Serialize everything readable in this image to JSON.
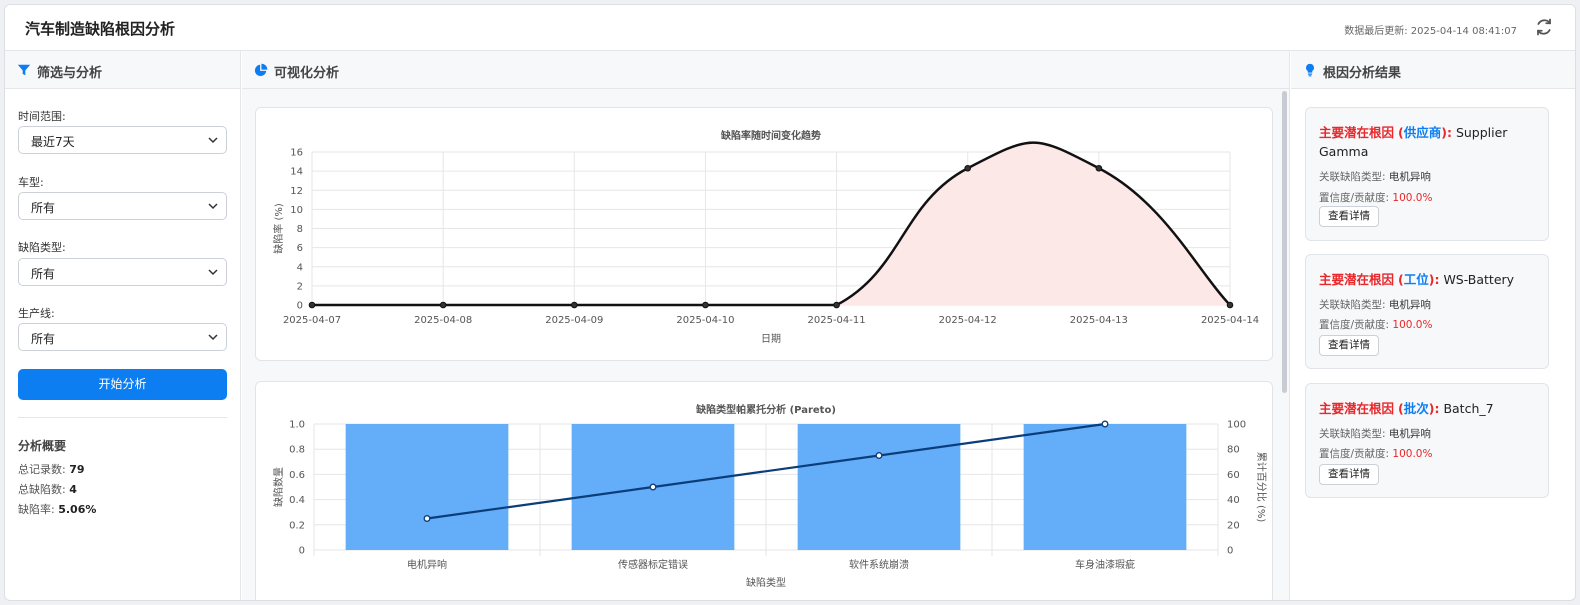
{
  "header": {
    "title": "汽车制造缺陷根因分析",
    "updated_label": "数据最后更新: 2025-04-14 08:41:07"
  },
  "filters": {
    "panel_title": "筛选与分析",
    "time_label": "时间范围:",
    "time_value": "最近7天",
    "model_label": "车型:",
    "model_value": "所有",
    "defect_label": "缺陷类型:",
    "defect_value": "所有",
    "line_label": "生产线:",
    "line_value": "所有",
    "analyze_button": "开始分析"
  },
  "summary": {
    "title": "分析概要",
    "total_records_label": "总记录数:",
    "total_records": "79",
    "total_defects_label": "总缺陷数:",
    "total_defects": "4",
    "defect_rate_label": "缺陷率:",
    "defect_rate": "5.06%"
  },
  "viz": {
    "panel_title": "可视化分析"
  },
  "rootcause": {
    "panel_title": "根因分析结果",
    "cards": [
      {
        "prefix": "主要潜在根因",
        "category": "供应商",
        "value": "Supplier Gamma",
        "related_label": "关联缺陷类型:",
        "related_value": "电机异响",
        "conf_label": "置信度/贡献度:",
        "conf_value": "100.0%",
        "button": "查看详情"
      },
      {
        "prefix": "主要潜在根因",
        "category": "工位",
        "value": "WS-Battery",
        "related_label": "关联缺陷类型:",
        "related_value": "电机异响",
        "conf_label": "置信度/贡献度:",
        "conf_value": "100.0%",
        "button": "查看详情"
      },
      {
        "prefix": "主要潜在根因",
        "category": "批次",
        "value": "Batch_7",
        "related_label": "关联缺陷类型:",
        "related_value": "电机异响",
        "conf_label": "置信度/贡献度:",
        "conf_value": "100.0%",
        "button": "查看详情"
      }
    ]
  },
  "colors": {
    "accent": "#0d7ef2",
    "alert": "#e8282b",
    "bar": "#64adf9",
    "area": "#fde8e8"
  },
  "chart_data": [
    {
      "type": "area",
      "title": "缺陷率随时间变化趋势",
      "xlabel": "日期",
      "ylabel": "缺陷率 (%)",
      "ylim": [
        0,
        16
      ],
      "yticks": [
        0,
        2,
        4,
        6,
        8,
        10,
        12,
        14,
        16
      ],
      "x": [
        "2025-04-07",
        "2025-04-08",
        "2025-04-09",
        "2025-04-10",
        "2025-04-11",
        "2025-04-12",
        "2025-04-13",
        "2025-04-14"
      ],
      "values": [
        0,
        0,
        0,
        0,
        0,
        14.3,
        14.3,
        0
      ],
      "grid": true
    },
    {
      "type": "bar",
      "title": "缺陷类型帕累托分析 (Pareto)",
      "xlabel": "缺陷类型",
      "ylabel": "缺陷数量",
      "y2label": "累计百分比 (%)",
      "ylim": [
        0,
        1.0
      ],
      "yticks": [
        0,
        0.2,
        0.4,
        0.6,
        0.8,
        1.0
      ],
      "y2lim": [
        0,
        100
      ],
      "y2ticks": [
        0,
        20,
        40,
        60,
        80,
        100
      ],
      "categories": [
        "电机异响",
        "传感器标定错误",
        "软件系统崩溃",
        "车身油漆瑕疵"
      ],
      "values": [
        1,
        1,
        1,
        1
      ],
      "cumulative_percent": [
        25,
        50,
        75,
        100
      ],
      "grid": true
    }
  ]
}
